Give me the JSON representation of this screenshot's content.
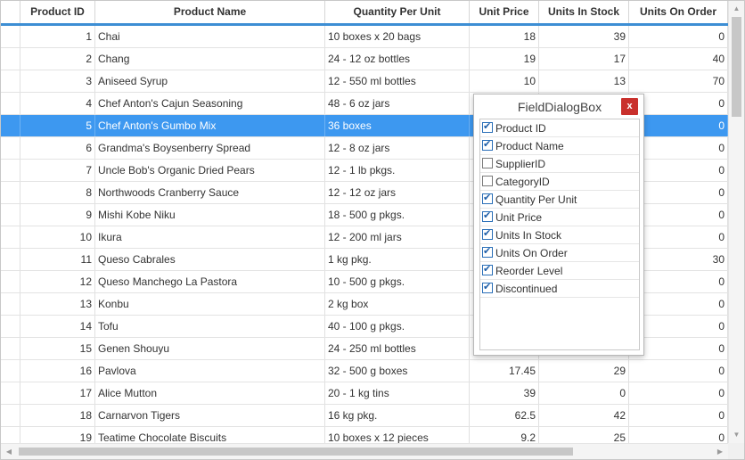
{
  "columns": [
    "Product ID",
    "Product Name",
    "Quantity Per Unit",
    "Unit Price",
    "Units In Stock",
    "Units On Order"
  ],
  "rows": [
    {
      "id": "1",
      "name": "Chai",
      "qty": "10 boxes x 20 bags",
      "price": "18",
      "stock": "39",
      "order": "0"
    },
    {
      "id": "2",
      "name": "Chang",
      "qty": "24 - 12 oz bottles",
      "price": "19",
      "stock": "17",
      "order": "40"
    },
    {
      "id": "3",
      "name": "Aniseed Syrup",
      "qty": "12 - 550 ml bottles",
      "price": "10",
      "stock": "13",
      "order": "70"
    },
    {
      "id": "4",
      "name": "Chef Anton's Cajun Seasoning",
      "qty": "48 - 6 oz jars",
      "price": "",
      "stock": "",
      "order": "0"
    },
    {
      "id": "5",
      "name": "Chef Anton's Gumbo Mix",
      "qty": "36 boxes",
      "price": "",
      "stock": "",
      "order": "0"
    },
    {
      "id": "6",
      "name": "Grandma's Boysenberry Spread",
      "qty": "12 - 8 oz jars",
      "price": "",
      "stock": "",
      "order": "0"
    },
    {
      "id": "7",
      "name": "Uncle Bob's Organic Dried Pears",
      "qty": "12 - 1 lb pkgs.",
      "price": "",
      "stock": "",
      "order": "0"
    },
    {
      "id": "8",
      "name": "Northwoods Cranberry Sauce",
      "qty": "12 - 12 oz jars",
      "price": "",
      "stock": "",
      "order": "0"
    },
    {
      "id": "9",
      "name": "Mishi Kobe Niku",
      "qty": "18 - 500 g pkgs.",
      "price": "",
      "stock": "",
      "order": "0"
    },
    {
      "id": "10",
      "name": "Ikura",
      "qty": "12 - 200 ml jars",
      "price": "",
      "stock": "",
      "order": "0"
    },
    {
      "id": "11",
      "name": "Queso Cabrales",
      "qty": "1 kg pkg.",
      "price": "",
      "stock": "",
      "order": "30"
    },
    {
      "id": "12",
      "name": "Queso Manchego La Pastora",
      "qty": "10 - 500 g pkgs.",
      "price": "",
      "stock": "",
      "order": "0"
    },
    {
      "id": "13",
      "name": "Konbu",
      "qty": "2 kg box",
      "price": "",
      "stock": "",
      "order": "0"
    },
    {
      "id": "14",
      "name": "Tofu",
      "qty": "40 - 100 g pkgs.",
      "price": "",
      "stock": "",
      "order": "0"
    },
    {
      "id": "15",
      "name": "Genen Shouyu",
      "qty": "24 - 250 ml bottles",
      "price": "",
      "stock": "",
      "order": "0"
    },
    {
      "id": "16",
      "name": "Pavlova",
      "qty": "32 - 500 g boxes",
      "price": "17.45",
      "stock": "29",
      "order": "0"
    },
    {
      "id": "17",
      "name": "Alice Mutton",
      "qty": "20 - 1 kg tins",
      "price": "39",
      "stock": "0",
      "order": "0"
    },
    {
      "id": "18",
      "name": "Carnarvon Tigers",
      "qty": "16 kg pkg.",
      "price": "62.5",
      "stock": "42",
      "order": "0"
    },
    {
      "id": "19",
      "name": "Teatime Chocolate Biscuits",
      "qty": "10 boxes x 12 pieces",
      "price": "9.2",
      "stock": "25",
      "order": "0"
    }
  ],
  "selected_row": 4,
  "dialog": {
    "title": "FieldDialogBox",
    "close_label": "x",
    "fields": [
      {
        "label": "Product ID",
        "checked": true
      },
      {
        "label": "Product Name",
        "checked": true
      },
      {
        "label": "SupplierID",
        "checked": false
      },
      {
        "label": "CategoryID",
        "checked": false
      },
      {
        "label": "Quantity Per Unit",
        "checked": true
      },
      {
        "label": "Unit Price",
        "checked": true
      },
      {
        "label": "Units In Stock",
        "checked": true
      },
      {
        "label": "Units On Order",
        "checked": true
      },
      {
        "label": "Reorder Level",
        "checked": true
      },
      {
        "label": "Discontinued",
        "checked": true
      }
    ]
  },
  "colors": {
    "accent": "#3d8ed4",
    "selection": "#3d98f0",
    "close": "#c9302c"
  },
  "icons": {
    "scroll_up": "▲",
    "scroll_down": "▼",
    "scroll_left": "◀",
    "scroll_right": "▶"
  }
}
